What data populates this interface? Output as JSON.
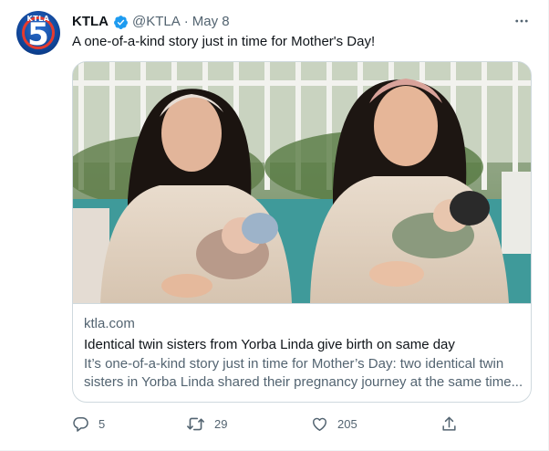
{
  "tweet": {
    "author_name": "KTLA",
    "handle": "@KTLA",
    "separator": "·",
    "date": "May 8",
    "text": "A one-of-a-kind story just in time for Mother's Day!",
    "avatar": {
      "wordmark": "KTLA",
      "number": "5"
    }
  },
  "card": {
    "domain": "ktla.com",
    "title": "Identical twin sisters from Yorba Linda give birth on same day",
    "description_line1": "It’s one-of-a-kind story just in time for Mother’s Day: two identical twin",
    "description_line2": "sisters in Yorba Linda shared their pregnancy journey at the same time..."
  },
  "actions": {
    "reply_count": "5",
    "retweet_count": "29",
    "like_count": "205"
  },
  "icons": {
    "verified": "verified-badge-icon",
    "more": "more-options-icon",
    "reply": "reply-icon",
    "retweet": "retweet-icon",
    "like": "heart-icon",
    "share": "share-icon"
  },
  "colors": {
    "text_primary": "#0f1419",
    "text_secondary": "#536471",
    "verified_blue": "#1d9bf0",
    "border": "#cfd9de"
  }
}
